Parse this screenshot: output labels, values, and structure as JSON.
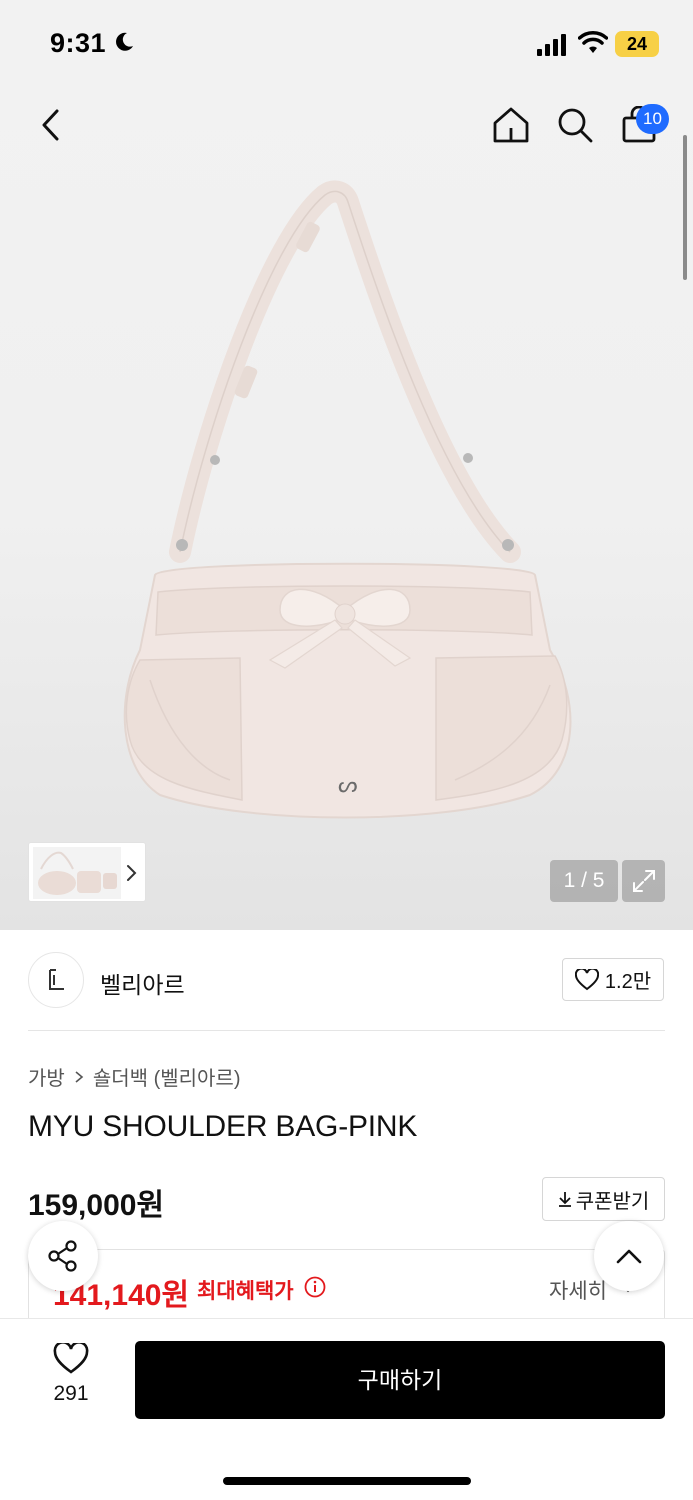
{
  "status_bar": {
    "time": "9:31",
    "battery": "24"
  },
  "nav": {
    "cart_count": "10"
  },
  "gallery": {
    "pager": "1 / 5"
  },
  "brand": {
    "name": "벨리아르",
    "favorite_count": "1.2만"
  },
  "breadcrumb": {
    "category": "가방",
    "subcategory": "숄더백 (벨리아르)"
  },
  "product": {
    "title": "MYU SHOULDER BAG-PINK",
    "price": "159,000원",
    "coupon_label": "쿠폰받기",
    "benefit_price": "141,140원",
    "benefit_label": "최대혜택가",
    "detail_link": "자세히"
  },
  "bottom_bar": {
    "like_count": "291",
    "buy_label": "구매하기"
  },
  "colors": {
    "accent": "#1f6bff",
    "sale": "#e3191d",
    "bag": "#f1e6e2",
    "battery": "#f7d046"
  }
}
